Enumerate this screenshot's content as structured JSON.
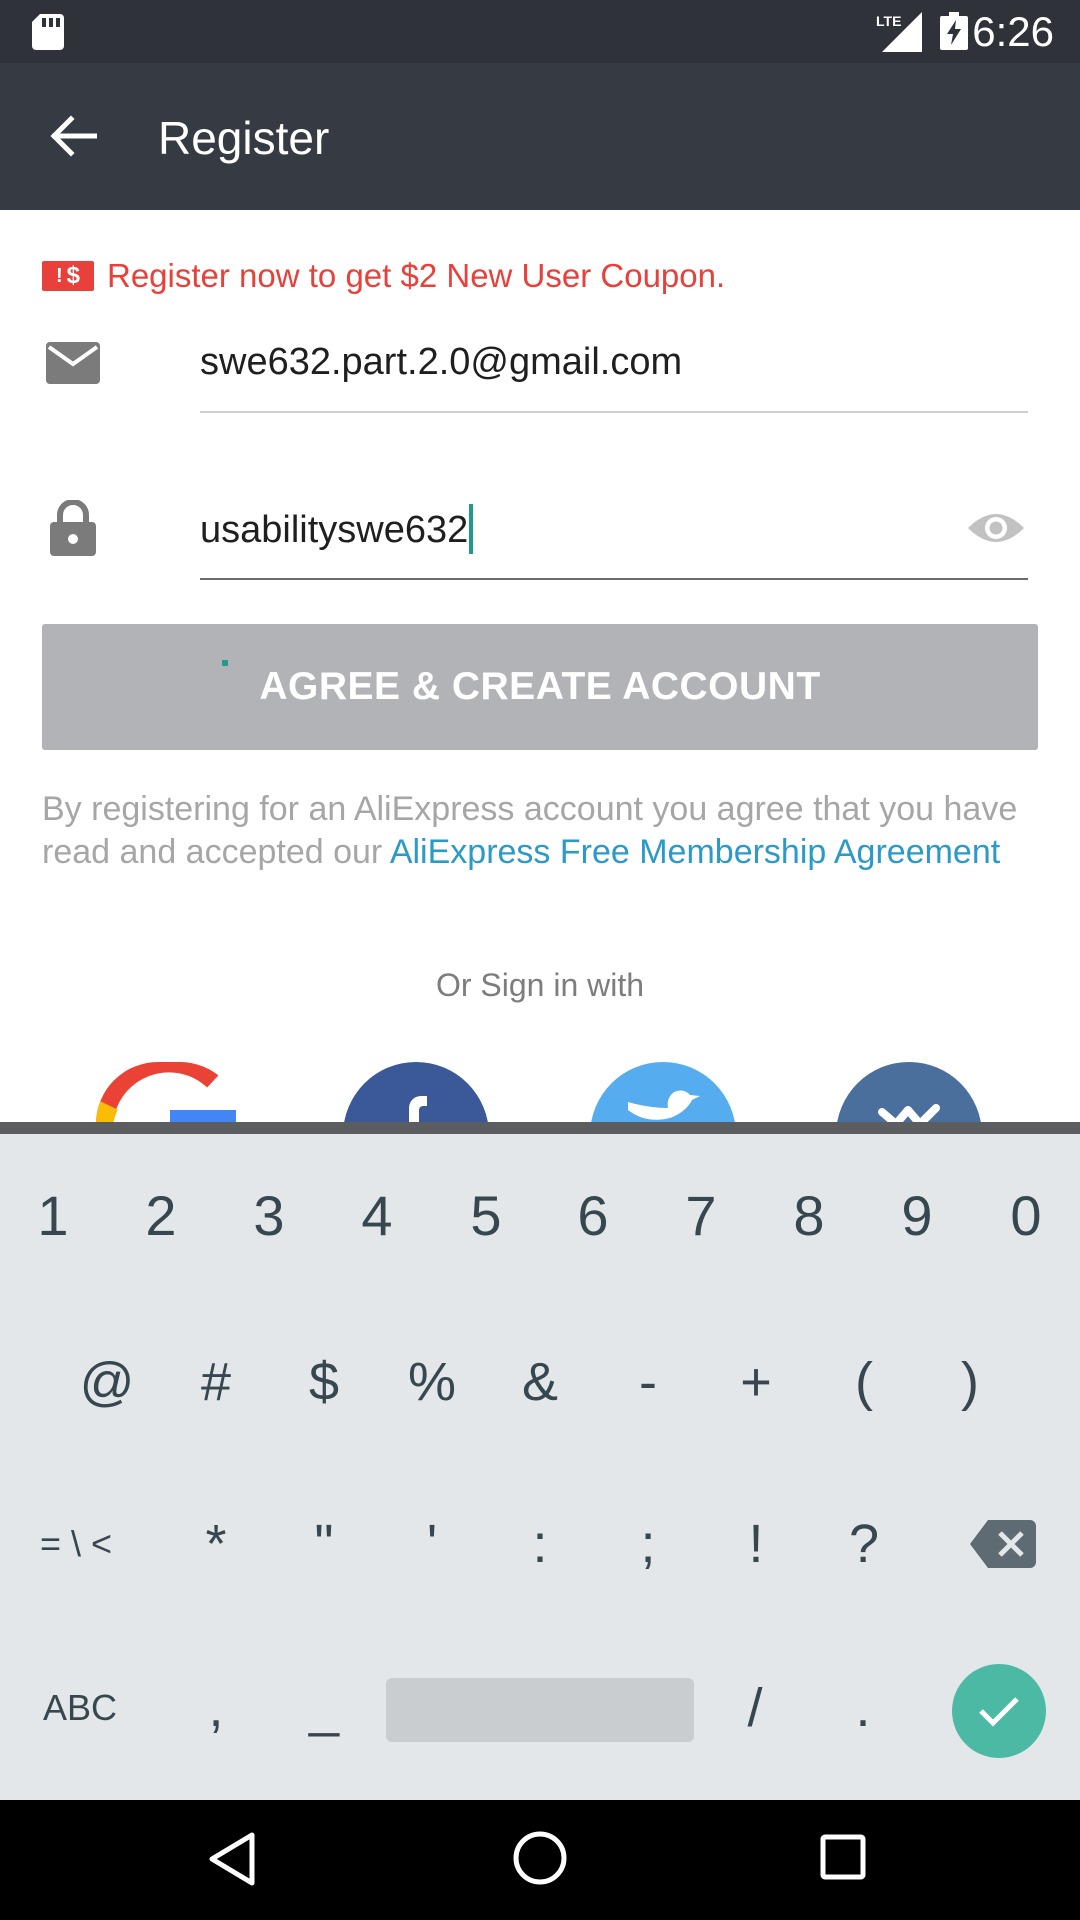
{
  "status_bar": {
    "time": "6:26",
    "network": "LTE"
  },
  "toolbar": {
    "title": "Register"
  },
  "promo": {
    "icon_text": "$",
    "text": "Register now to get $2 New User Coupon."
  },
  "form": {
    "email_value": "swe632.part.2.0@gmail.com",
    "password_value": "usabilityswe632"
  },
  "create_button": {
    "label": "AGREE & CREATE ACCOUNT"
  },
  "legal": {
    "text": "By registering for an AliExpress account you agree that you have read and accepted our ",
    "link": "AliExpress Free Membership Agreement"
  },
  "social": {
    "heading": "Or Sign in with",
    "providers": [
      "google",
      "facebook",
      "twitter",
      "vk"
    ]
  },
  "keyboard": {
    "row1": [
      "1",
      "2",
      "3",
      "4",
      "5",
      "6",
      "7",
      "8",
      "9",
      "0"
    ],
    "row2": [
      "@",
      "#",
      "$",
      "%",
      "&",
      "-",
      "+",
      "(",
      ")"
    ],
    "row3": [
      "= \\ <",
      "*",
      "\"",
      "'",
      ":",
      ";",
      "!",
      "?"
    ],
    "row4": [
      "ABC",
      ",",
      "_",
      "/",
      "."
    ]
  },
  "colors": {
    "accent": "#e8413b",
    "link": "#2b9ac9",
    "teal": "#1f9b8e",
    "toolbar": "#363a42"
  }
}
